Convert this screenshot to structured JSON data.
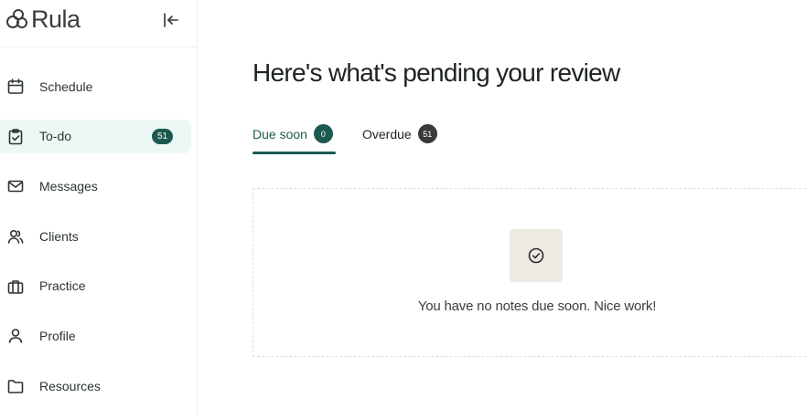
{
  "brand": {
    "logo_text": "Rula"
  },
  "sidebar": {
    "items": [
      {
        "label": "Schedule",
        "icon": "calendar-icon"
      },
      {
        "label": "To-do",
        "icon": "clipboard-check-icon",
        "badge": "51",
        "active": true
      },
      {
        "label": "Messages",
        "icon": "mail-icon"
      },
      {
        "label": "Clients",
        "icon": "users-icon"
      },
      {
        "label": "Practice",
        "icon": "briefcase-icon"
      },
      {
        "label": "Profile",
        "icon": "user-icon"
      },
      {
        "label": "Resources",
        "icon": "folder-icon"
      }
    ]
  },
  "main": {
    "title": "Here's what's pending your review",
    "tabs": [
      {
        "label": "Due soon",
        "count": "0",
        "active": true
      },
      {
        "label": "Overdue",
        "count": "51"
      }
    ],
    "empty_state": {
      "message": "You have no notes due soon. Nice work!",
      "icon": "check-circle-icon"
    }
  },
  "colors": {
    "accent": "#1c5a4f",
    "active_bg": "#ecf8f5",
    "empty_icon_bg": "#eee9e3"
  }
}
